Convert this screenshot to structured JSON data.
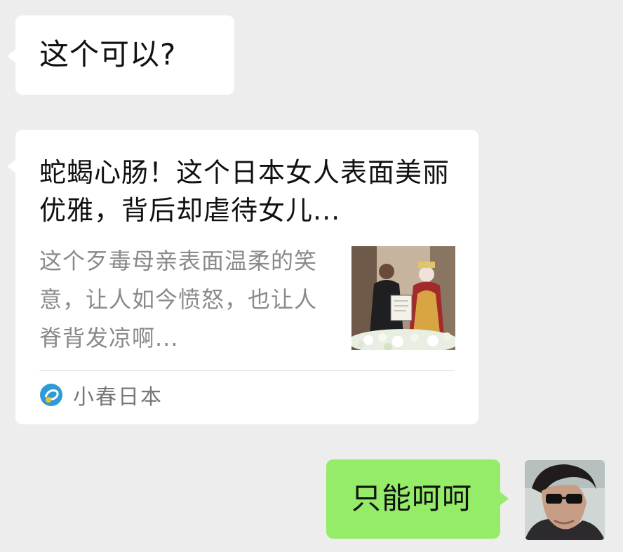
{
  "messages": {
    "incoming_text": "这个可以?",
    "article": {
      "title": "蛇蝎心肠！这个日本女人表面美丽优雅，背后却虐待女儿...",
      "description": "这个歹毒母亲表面温柔的笑意，让人如今愤怒，也让人脊背发凉啊...",
      "source": "小春日本",
      "thumbnail_icon": "wedding-photo-thumbnail",
      "source_icon": "source-logo-icon"
    },
    "outgoing_text": "只能呵呵"
  },
  "colors": {
    "background": "#ededed",
    "incoming_bubble": "#ffffff",
    "outgoing_bubble": "#95ec69",
    "secondary_text": "#8a8a8a",
    "source_logo": "#2f9bd6"
  },
  "avatar": {
    "icon": "user-avatar"
  }
}
